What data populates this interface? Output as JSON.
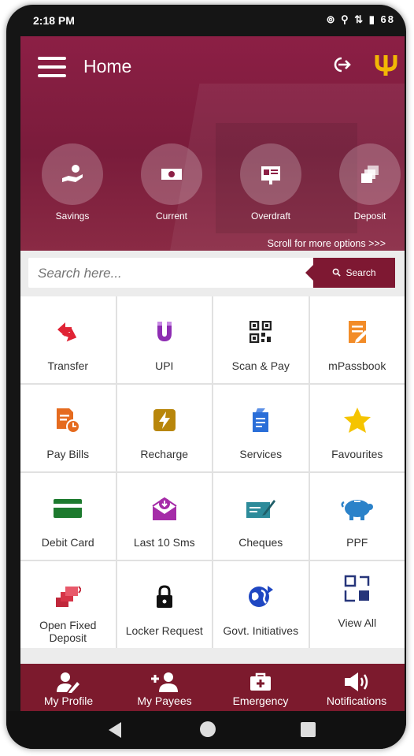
{
  "status_bar": {
    "time": "2:18 PM",
    "indicators": "⊚ ⚲ ⇅ ▮ 68"
  },
  "header": {
    "title": "Home",
    "logout_icon": "logout-icon",
    "brand_logo": "pnb-logo"
  },
  "account_categories": [
    {
      "label": "Savings",
      "icon": "hand-money-icon"
    },
    {
      "label": "Current",
      "icon": "banknote-icon"
    },
    {
      "label": "Overdraft",
      "icon": "overdraft-icon"
    },
    {
      "label": "Deposit",
      "icon": "deposit-icon"
    }
  ],
  "scroll_hint": "Scroll for more options >>>",
  "search": {
    "placeholder": "Search here...",
    "button_label": "Search"
  },
  "services": [
    {
      "label": "Transfer"
    },
    {
      "label": "UPI"
    },
    {
      "label": "Scan & Pay"
    },
    {
      "label": "mPassbook"
    },
    {
      "label": "Pay Bills"
    },
    {
      "label": "Recharge"
    },
    {
      "label": "Services"
    },
    {
      "label": "Favourites"
    },
    {
      "label": "Debit Card"
    },
    {
      "label": "Last 10 Sms"
    },
    {
      "label": "Cheques"
    },
    {
      "label": "PPF"
    },
    {
      "label": "Open Fixed Deposit"
    },
    {
      "label": "Locker Request"
    },
    {
      "label": "Govt. Initiatives"
    },
    {
      "label": "View All"
    }
  ],
  "bottom_nav": [
    {
      "label": "My Profile"
    },
    {
      "label": "My Payees"
    },
    {
      "label": "Emergency"
    },
    {
      "label": "Notifications"
    }
  ],
  "colors": {
    "brand_maroon": "#7c1a2d",
    "hero": "#8c1f45",
    "accent_yellow": "#f2b705"
  }
}
